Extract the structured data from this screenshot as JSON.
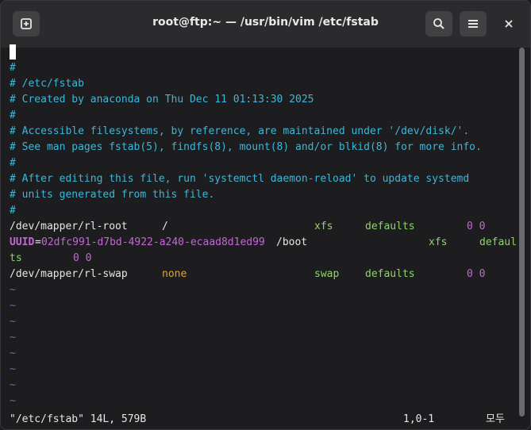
{
  "window": {
    "title": "root@ftp:~ — /usr/bin/vim /etc/fstab"
  },
  "icons": {
    "new_tab": "new-tab-icon",
    "search": "search-icon",
    "menu": "hamburger-menu-icon",
    "close": "close-icon"
  },
  "editor": {
    "comments": [
      "#",
      "# /etc/fstab",
      "# Created by anaconda on Thu Dec 11 01:13:30 2025",
      "#",
      "# Accessible filesystems, by reference, are maintained under '/dev/disk/'.",
      "# See man pages fstab(5), findfs(8), mount(8) and/or blkid(8) for more info.",
      "#",
      "# After editing this file, run 'systemctl daemon-reload' to update systemd",
      "# units generated from this file.",
      "#"
    ],
    "entry1": {
      "device": "/dev/mapper/rl-root",
      "mount": "/",
      "fstype": "xfs",
      "options": "defaults",
      "dump_pass": "0 0"
    },
    "entry2": {
      "uuid_label": "UUID",
      "eq": "=",
      "uuid_value": "02dfc991-d7bd-4922-a240-ecaad8d1ed99",
      "mount": "/boot",
      "fstype": "xfs",
      "options_part1": "defaul",
      "options_part2": "ts",
      "dump_pass": "0 0"
    },
    "entry3": {
      "device": "/dev/mapper/rl-swap",
      "mount": "none",
      "fstype": "swap",
      "options": "defaults",
      "dump_pass": "0 0"
    },
    "tildes": [
      "~",
      "~",
      "~",
      "~",
      "~",
      "~",
      "~",
      "~"
    ]
  },
  "status": {
    "file_info": "\"/etc/fstab\" 14L, 579B",
    "position": "1,0-1",
    "scroll": "모두"
  },
  "colors": {
    "comment": "#3fb6d8",
    "type": "#8fd36a",
    "number": "#c466d6",
    "special": "#e0a62a",
    "tilde": "#4b78b8"
  }
}
